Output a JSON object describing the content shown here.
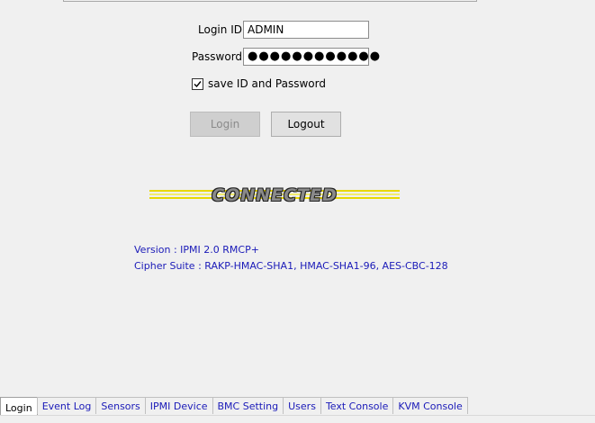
{
  "login": {
    "id_label": "Login ID",
    "id_value": "ADMIN",
    "password_label": "Password",
    "password_value": "●●●●●●●●●●●●",
    "save_checked": true,
    "save_label": "save ID and Password",
    "login_button": "Login",
    "logout_button": "Logout"
  },
  "status": {
    "logo_text": "CONNECTED",
    "version": "Version : IPMI 2.0 RMCP+",
    "cipher": "Cipher Suite : RAKP-HMAC-SHA1, HMAC-SHA1-96, AES-CBC-128"
  },
  "tabs": [
    "Login",
    "Event Log",
    "Sensors",
    "IPMI Device",
    "BMC Setting",
    "Users",
    "Text Console",
    "KVM Console"
  ],
  "active_tab": "Login",
  "colors": {
    "info_text": "#1a1ab8",
    "logo_stripe": "#e8d800"
  }
}
